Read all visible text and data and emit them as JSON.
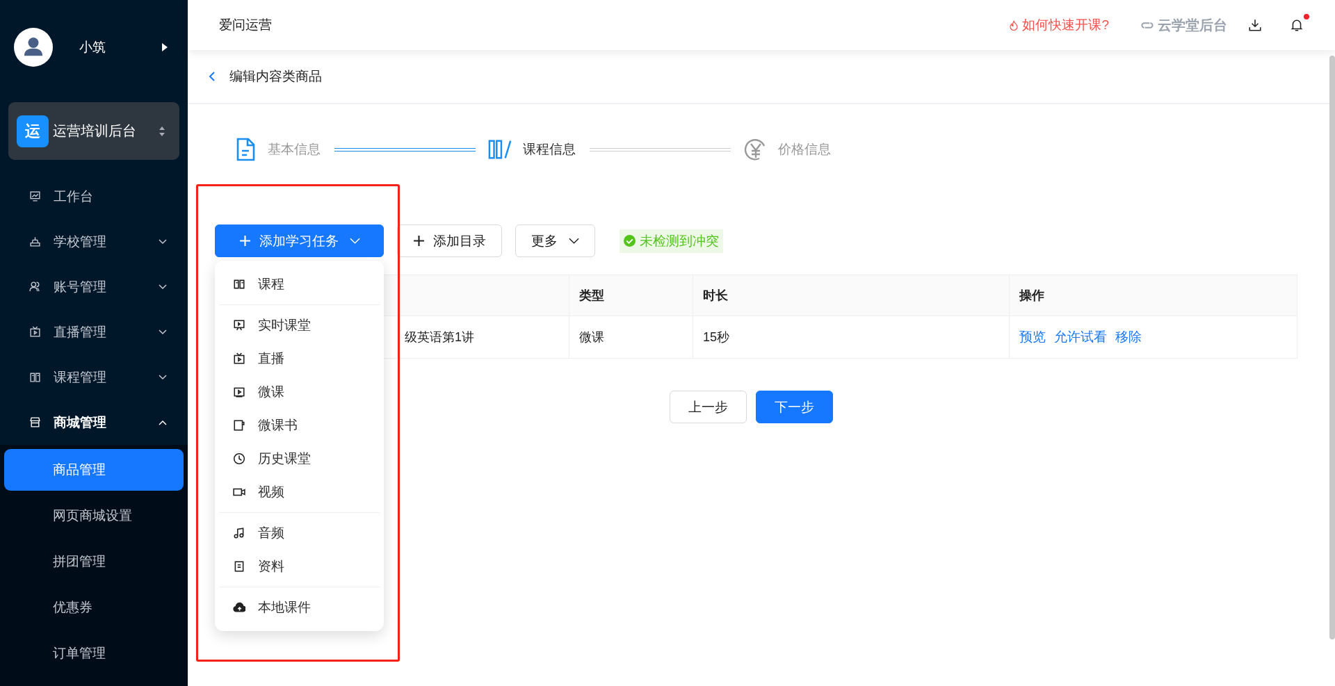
{
  "sidebar": {
    "user": {
      "name": "小筑"
    },
    "org": {
      "badge": "运",
      "name": "运营培训后台"
    },
    "menu": [
      {
        "label": "工作台",
        "kind": "link",
        "expanded": false
      },
      {
        "label": "学校管理",
        "kind": "group",
        "expanded": false
      },
      {
        "label": "账号管理",
        "kind": "group",
        "expanded": false
      },
      {
        "label": "直播管理",
        "kind": "group",
        "expanded": false
      },
      {
        "label": "课程管理",
        "kind": "group",
        "expanded": false
      },
      {
        "label": "商城管理",
        "kind": "group",
        "expanded": true,
        "children": [
          {
            "label": "商品管理",
            "selected": true
          },
          {
            "label": "网页商城设置",
            "selected": false
          },
          {
            "label": "拼团管理",
            "selected": false
          },
          {
            "label": "优惠券",
            "selected": false
          },
          {
            "label": "订单管理",
            "selected": false
          }
        ]
      }
    ]
  },
  "header": {
    "app_name": "爱问运营",
    "help_link": "如何快速开课?",
    "switch_link": "云学堂后台",
    "has_unread": true
  },
  "page_title": "编辑内容类商品",
  "steps": [
    {
      "label": "基本信息",
      "completed": true,
      "selected": false
    },
    {
      "label": "课程信息",
      "completed": false,
      "selected": true
    },
    {
      "label": "价格信息",
      "completed": false,
      "selected": false
    }
  ],
  "toolbar": {
    "add_task": "添加学习任务",
    "add_catalog": "添加目录",
    "more": "更多",
    "conflict_status": "未检测到冲突"
  },
  "task_menu": [
    [
      "课程"
    ],
    [
      "实时课堂",
      "直播",
      "微课",
      "微课书",
      "历史课堂",
      "视频"
    ],
    [
      "音频",
      "资料"
    ],
    [
      "本地课件"
    ]
  ],
  "table": {
    "columns": [
      "类型",
      "时长",
      "操作"
    ],
    "rows": [
      {
        "column_1": "级英语第1讲",
        "type": "微课",
        "duration": "15秒",
        "actions": [
          "预览",
          "允许试看",
          "移除"
        ]
      }
    ]
  },
  "footer": {
    "prev": "上一步",
    "next": "下一步"
  }
}
